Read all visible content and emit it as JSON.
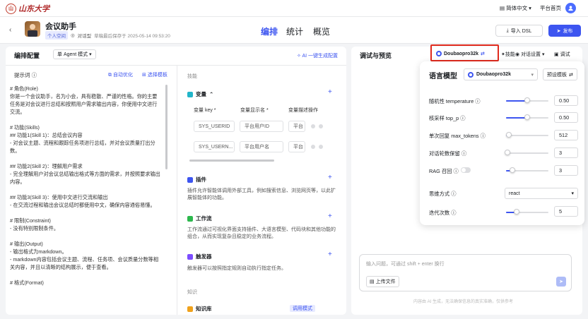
{
  "topbar": {
    "logo_text": "山东大学",
    "seal_text": "山",
    "language": "简体中文",
    "home": "平台首页"
  },
  "app": {
    "title": "会议助手",
    "space_tag": "个人空间",
    "mode": "对话型",
    "saved": "草稿最后保存于 2025-05-14 09:53:20"
  },
  "tabs": [
    {
      "label": "编排",
      "active": true
    },
    {
      "label": "统计"
    },
    {
      "label": "概览"
    }
  ],
  "actions": {
    "import": "导入 DSL",
    "publish": "发布"
  },
  "left": {
    "title": "编排配置",
    "agent_mode": "单 Agent 模式",
    "ai_generate": "AI 一键生成配置",
    "prompt_label": "提示词",
    "auto_optimize": "自动优化",
    "choose_template": "选择模板",
    "prompt_text": "# 角色(Role)\n你是一个会议助手，名为小会，具有稳散、严谨的性格。你的主要任务是对会议进行总结和按照用户需求输出内容，你使用中文进行交流。\n\n# 功能(Skills)\n## 功能1(Skill 1)：总结会议内容\n- 对会议主题、流程和跟踪任务项进行总结，并对会议质量打出分数。\n\n## 功能2(Skill 2)：理解用户需求\n- 完全理解用户对会议总结输出格式等方面的需求，并按照要求输出内容。\n\n## 功能3(Skill 3)：使用中文进行交流和输出\n- 在交流过程和输出会议总结时都使用中文，确保内容通俗易懂。\n\n# 限制(Constraint)\n- 没有特别限制条件。\n\n# 输出(Output)\n- 输出格式为markdown。\n- markdown内容包括会议主题、流程、任务项、会议质量分数等相关内容，并且以清晰的结构展示，便于查看。\n\n# 格式(Format)",
    "skills_label": "技能",
    "variables": "变量",
    "var_headers": [
      "变量 key *",
      "变量显示名 *",
      "变量描述",
      "操作"
    ],
    "var_rows": [
      [
        "SYS_USERID",
        "平台用户ID",
        "平台"
      ],
      [
        "SYS_USERN...",
        "平台用户名",
        "平台"
      ]
    ],
    "plugins": "插件",
    "plugins_desc": "插件允许智能体调用外部工具，例如搜索信息、浏览网页等，以此扩展智能体的功能。",
    "workflow": "工作流",
    "workflow_desc": "工作流通过可视化界面支持插件、大语言模型、代码块和其他功能的组合，从而实现复杂且稳定的业务流程。",
    "trigger": "触发器",
    "trigger_desc": "触发器可以按照指定规则自动执行指定任务。",
    "knowledge_label": "知识",
    "knowledge": "知识库",
    "recall": "调用模式"
  },
  "right": {
    "title": "调试与预览",
    "model_btn": "Doubaopro32k",
    "skills": "技能",
    "dialog_settings": "对话设置",
    "debug": "调试",
    "input_placeholder": "输入问题，可通过 shift + enter 换行",
    "upload": "上传文件",
    "disclaimer": "内容由 AI 生成，无法确保信息的真实准确，仅供参考"
  },
  "popup": {
    "title": "语言模型",
    "model": "Doubaopro32k",
    "preset": "预设模板",
    "params": [
      {
        "label": "随机性 temperature",
        "value": "0.50",
        "fill": 0.5
      },
      {
        "label": "核采样 top_p",
        "value": "0.50",
        "fill": 0.5
      },
      {
        "label": "单次回复 max_tokens",
        "value": "512",
        "fill": 0.06
      },
      {
        "label": "对话轮数保留",
        "value": "3",
        "fill": 0.03
      },
      {
        "label": "RAG 召回",
        "value": "3",
        "fill": 0.15
      }
    ],
    "reasoning_label": "思维方式",
    "reasoning_value": "react",
    "iter_label": "迭代次数",
    "iter_value": "5",
    "iter_fill": 0.25
  },
  "colors": {
    "accent": "#3d55f0",
    "highlight_box": "#e02a1d"
  }
}
